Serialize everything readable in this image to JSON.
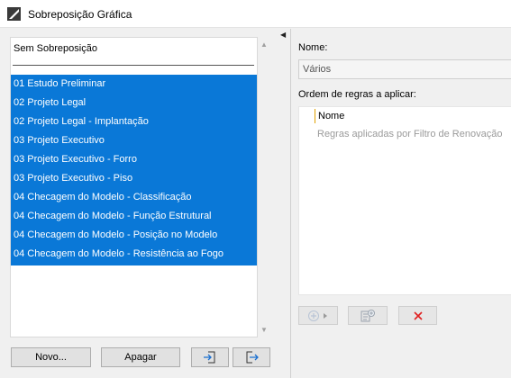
{
  "window": {
    "title": "Sobreposição Gráfica"
  },
  "list": {
    "none_item": "Sem Sobreposição",
    "items": [
      "01 Estudo Preliminar",
      "02 Projeto Legal",
      "02 Projeto Legal - Implantação",
      "03 Projeto Executivo",
      "03 Projeto Executivo - Forro",
      "03 Projeto Executivo - Piso",
      "04 Checagem do Modelo - Classificação",
      "04 Checagem do Modelo - Função Estrutural",
      "04 Checagem do Modelo - Posição no Modelo",
      "04 Checagem do Modelo - Resistência ao Fogo"
    ]
  },
  "buttons": {
    "new_label": "Novo...",
    "delete_label": "Apagar"
  },
  "details": {
    "name_label": "Nome:",
    "name_value": "Vários",
    "rules_label": "Ordem de regras a aplicar:",
    "rules_column": "Nome",
    "rules_row": "Regras aplicadas por Filtro de Renovação"
  },
  "colors": {
    "selection": "#0a78d7",
    "delete_icon": "#e02020"
  }
}
